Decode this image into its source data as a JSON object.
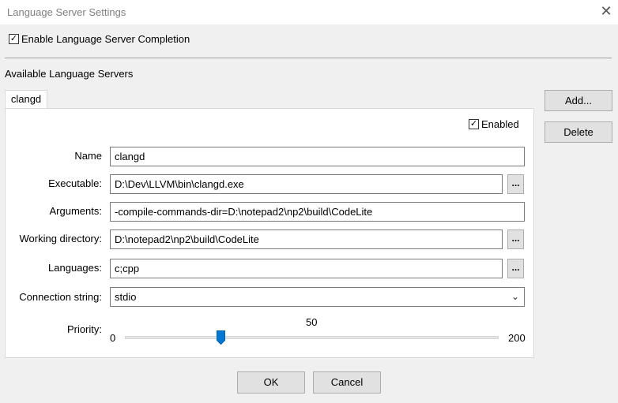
{
  "window": {
    "title": "Language Server Settings"
  },
  "enable_completion": {
    "label": "Enable Language Server Completion",
    "checked": true
  },
  "servers_heading": "Available Language Servers",
  "tabs": [
    {
      "label": "clangd"
    }
  ],
  "server": {
    "enabled_label": "Enabled",
    "enabled": true,
    "name_label": "Name",
    "name_value": "clangd",
    "executable_label": "Executable:",
    "executable_value": "D:\\Dev\\LLVM\\bin\\clangd.exe",
    "arguments_label": "Arguments:",
    "arguments_value": "-compile-commands-dir=D:\\notepad2\\np2\\build\\CodeLite",
    "workdir_label": "Working directory:",
    "workdir_value": "D:\\notepad2\\np2\\build\\CodeLite",
    "languages_label": "Languages:",
    "languages_value": "c;cpp",
    "connection_label": "Connection string:",
    "connection_value": "stdio",
    "priority_label": "Priority:",
    "priority": {
      "min": "0",
      "max": "200",
      "value": "50"
    },
    "browse_label": "..."
  },
  "buttons": {
    "add": "Add...",
    "delete": "Delete",
    "ok": "OK",
    "cancel": "Cancel"
  },
  "icons": {
    "close": "close-icon",
    "check": "checkmark-icon",
    "chevron": "chevron-down-icon"
  }
}
